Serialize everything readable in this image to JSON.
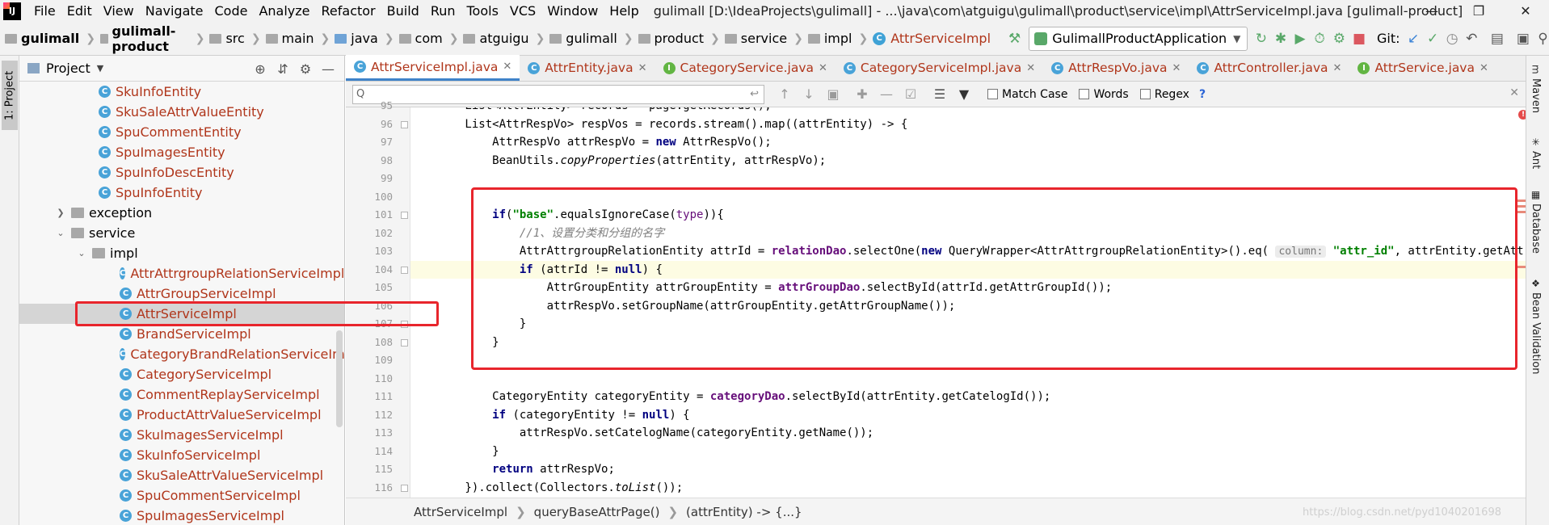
{
  "menubar": {
    "items": [
      "File",
      "Edit",
      "View",
      "Navigate",
      "Code",
      "Analyze",
      "Refactor",
      "Build",
      "Run",
      "Tools",
      "VCS",
      "Window",
      "Help"
    ],
    "window_title": "gulimall [D:\\IdeaProjects\\gulimall] - ...\\java\\com\\atguigu\\gulimall\\product\\service\\impl\\AttrServiceImpl.java [gulimall-product]"
  },
  "navbar": {
    "crumbs": [
      "gulimall",
      "gulimall-product",
      "src",
      "main",
      "java",
      "com",
      "atguigu",
      "gulimall",
      "product",
      "service",
      "impl",
      "AttrServiceImpl"
    ],
    "run_config": "GulimallProductApplication",
    "git_label": "Git:"
  },
  "left_strip": {
    "tab": "1: Project"
  },
  "project_panel": {
    "title": "Project",
    "rows": [
      {
        "label": "SkuInfoEntity"
      },
      {
        "label": "SkuSaleAttrValueEntity"
      },
      {
        "label": "SpuCommentEntity"
      },
      {
        "label": "SpuImagesEntity"
      },
      {
        "label": "SpuInfoDescEntity"
      },
      {
        "label": "SpuInfoEntity"
      },
      {
        "label": "exception"
      },
      {
        "label": "service"
      },
      {
        "label": "impl"
      },
      {
        "label": "AttrAttrgroupRelationServiceImpl"
      },
      {
        "label": "AttrGroupServiceImpl"
      },
      {
        "label": "AttrServiceImpl"
      },
      {
        "label": "BrandServiceImpl"
      },
      {
        "label": "CategoryBrandRelationServiceImpl"
      },
      {
        "label": "CategoryServiceImpl"
      },
      {
        "label": "CommentReplayServiceImpl"
      },
      {
        "label": "ProductAttrValueServiceImpl"
      },
      {
        "label": "SkuImagesServiceImpl"
      },
      {
        "label": "SkuInfoServiceImpl"
      },
      {
        "label": "SkuSaleAttrValueServiceImpl"
      },
      {
        "label": "SpuCommentServiceImpl"
      },
      {
        "label": "SpuImagesServiceImpl"
      }
    ]
  },
  "editor_tabs": [
    {
      "label": "AttrServiceImpl.java"
    },
    {
      "label": "AttrEntity.java"
    },
    {
      "label": "CategoryService.java"
    },
    {
      "label": "CategoryServiceImpl.java"
    },
    {
      "label": "AttrRespVo.java"
    },
    {
      "label": "AttrController.java"
    },
    {
      "label": "AttrService.java"
    }
  ],
  "findbar": {
    "placeholder": "Q",
    "match_case": "Match Case",
    "words": "Words",
    "regex": "Regex",
    "help": "?"
  },
  "editor": {
    "line_numbers": [
      "95",
      "96",
      "97",
      "98",
      "99",
      "100",
      "101",
      "102",
      "103",
      "104",
      "105",
      "106",
      "107",
      "108",
      "109",
      "110",
      "111",
      "112",
      "113",
      "114",
      "115",
      "116"
    ],
    "hint_label": "column:"
  },
  "footer": {
    "crumbs": [
      "AttrServiceImpl",
      "queryBaseAttrPage()",
      "(attrEntity) -> {...}"
    ],
    "watermark": "https://blog.csdn.net/pyd1040201698"
  },
  "right_strip": [
    "Maven",
    "Ant",
    "Database",
    "Bean Validation"
  ]
}
